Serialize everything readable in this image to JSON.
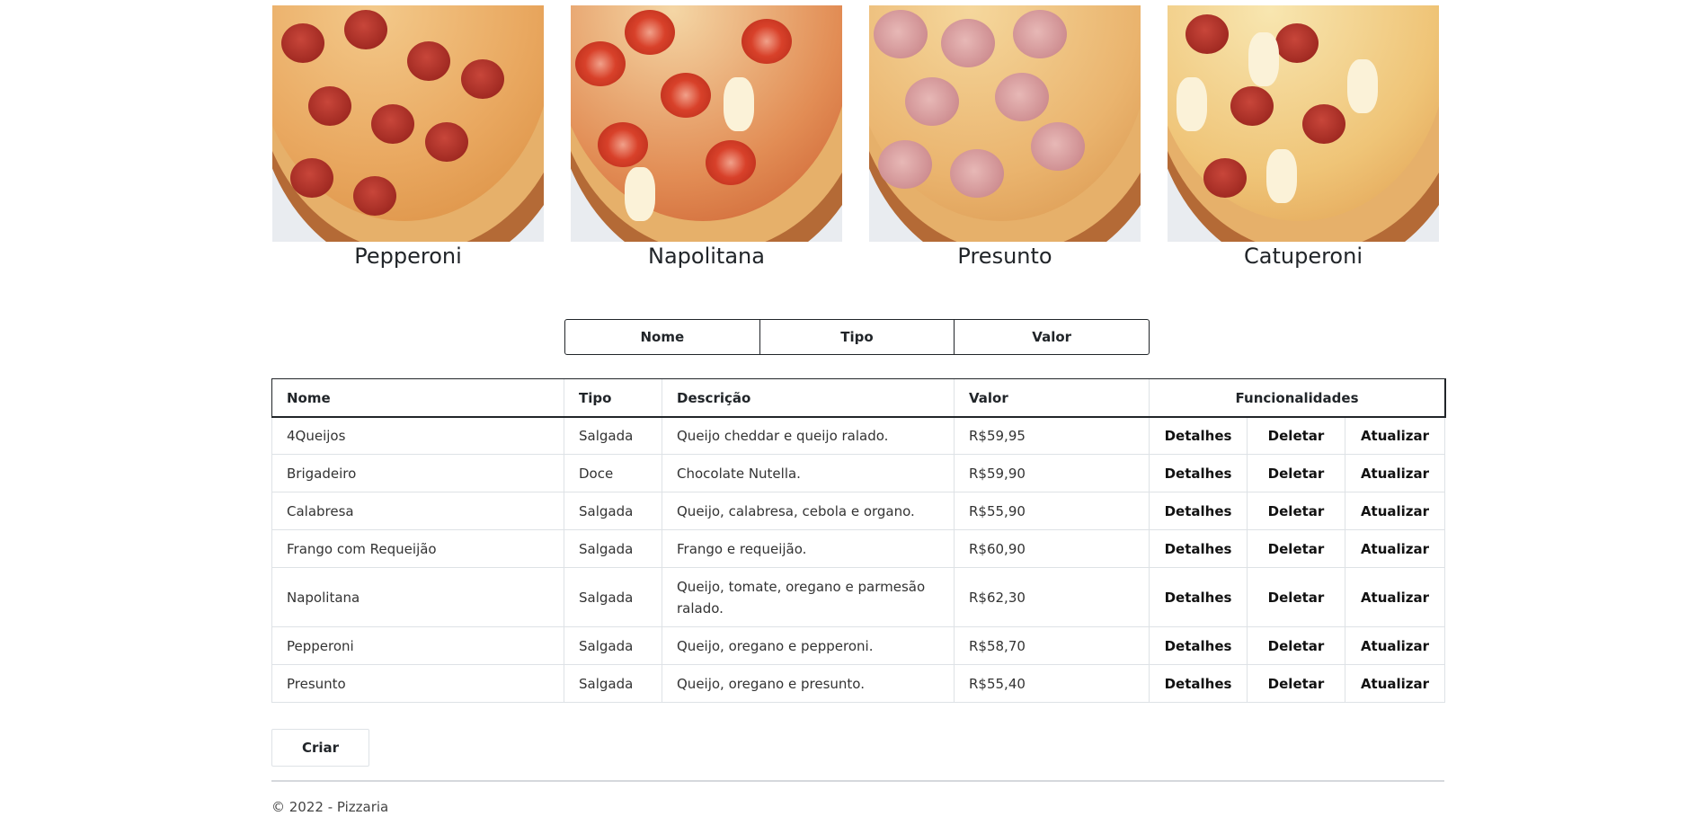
{
  "pizzas": [
    {
      "name": "Pepperoni",
      "style": "pep"
    },
    {
      "name": "Napolitana",
      "style": "nap"
    },
    {
      "name": "Presunto",
      "style": "pre"
    },
    {
      "name": "Catuperoni",
      "style": "cat"
    }
  ],
  "sort": {
    "nome": "Nome",
    "tipo": "Tipo",
    "valor": "Valor"
  },
  "table": {
    "headers": {
      "nome": "Nome",
      "tipo": "Tipo",
      "descricao": "Descrição",
      "valor": "Valor",
      "funcionalidades": "Funcionalidades"
    },
    "actions": {
      "detalhes": "Detalhes",
      "deletar": "Deletar",
      "atualizar": "Atualizar"
    },
    "rows": [
      {
        "nome": "4Queijos",
        "tipo": "Salgada",
        "descricao": "Queijo cheddar e queijo ralado.",
        "valor": "R$59,95"
      },
      {
        "nome": "Brigadeiro",
        "tipo": "Doce",
        "descricao": "Chocolate Nutella.",
        "valor": "R$59,90"
      },
      {
        "nome": "Calabresa",
        "tipo": "Salgada",
        "descricao": "Queijo, calabresa, cebola e organo.",
        "valor": "R$55,90"
      },
      {
        "nome": "Frango com Requeijão",
        "tipo": "Salgada",
        "descricao": "Frango e requeijão.",
        "valor": "R$60,90"
      },
      {
        "nome": "Napolitana",
        "tipo": "Salgada",
        "descricao": "Queijo, tomate, oregano e parmesão ralado.",
        "valor": "R$62,30"
      },
      {
        "nome": "Pepperoni",
        "tipo": "Salgada",
        "descricao": "Queijo, oregano e pepperoni.",
        "valor": "R$58,70"
      },
      {
        "nome": "Presunto",
        "tipo": "Salgada",
        "descricao": "Queijo, oregano e presunto.",
        "valor": "R$55,40"
      }
    ]
  },
  "criar_label": "Criar",
  "footer": "© 2022 - Pizzaria"
}
